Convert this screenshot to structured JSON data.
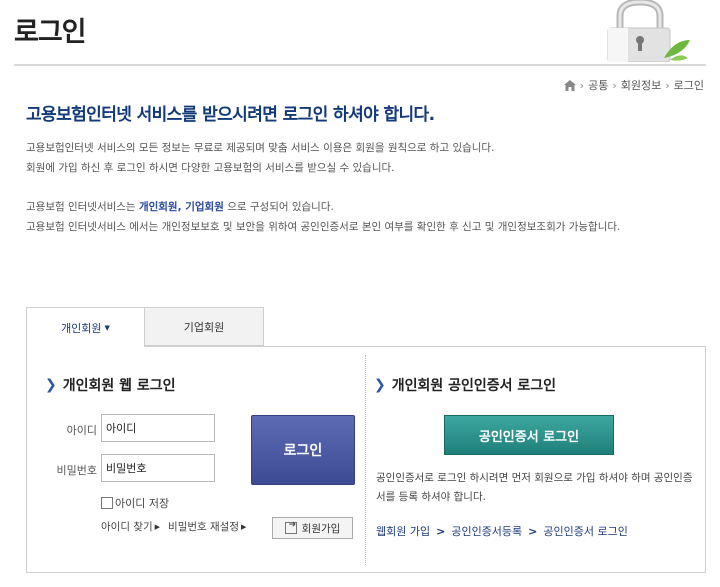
{
  "page": {
    "title": "로그인"
  },
  "breadcrumb": {
    "items": [
      "공통",
      "회원정보",
      "로그인"
    ]
  },
  "intro": {
    "headline": "고용보험인터넷 서비스를 받으시려면 로그인 하셔야 합니다.",
    "line1": "고용보험인터넷 서비스의 모든 정보는 무료로 제공되며 맞춤 서비스 이용은 회원을 원칙으로 하고 있습니다.",
    "line2": "회원에 가입 하신 후 로그인 하시면 다양한 고용보험의 서비스를 받으실 수 있습니다.",
    "line3_pre": "고용보험 인터넷서비스는 ",
    "line3_highlight": "개인회원, 기업회원",
    "line3_post": " 으로 구성되어 있습니다.",
    "line4": "고용보험 인터넷서비스 에서는 개인정보보호 및 보안을 위하여 공인인증서로 본인 여부를 확인한 후 신고 및 개인정보조회가 가능합니다."
  },
  "tabs": [
    {
      "label": "개인회원",
      "active": true
    },
    {
      "label": "기업회원",
      "active": false
    }
  ],
  "web_login": {
    "title": "개인회원 웹 로그인",
    "id_label": "아이디",
    "id_value": "아이디",
    "pw_label": "비밀번호",
    "pw_value": "비밀번호",
    "login_button": "로그인",
    "save_id_label": "아이디 저장",
    "find_id_link": "아이디 찾기",
    "reset_pw_link": "비밀번호 재설정",
    "join_button": "회원가입"
  },
  "cert_login": {
    "title": "개인회원 공인인증서 로그인",
    "button": "공인인증서 로그인",
    "description": "공인인증서로 로그인 하시려면 먼저 회원으로 가입 하셔야 하며 공인인증서를 등록 하셔야 합니다.",
    "steps": [
      "웹회원 가입",
      "공인인증서등록",
      "공인인증서 로그인"
    ]
  },
  "colors": {
    "headline": "#123a7a",
    "login_button": "#4a5aa4",
    "cert_button": "#2a8f88",
    "link": "#1c3a7c"
  },
  "icons": [
    "lock-icon",
    "home-icon",
    "chevron-right-icon",
    "caret-down-icon",
    "checkbox-icon",
    "join-icon"
  ]
}
